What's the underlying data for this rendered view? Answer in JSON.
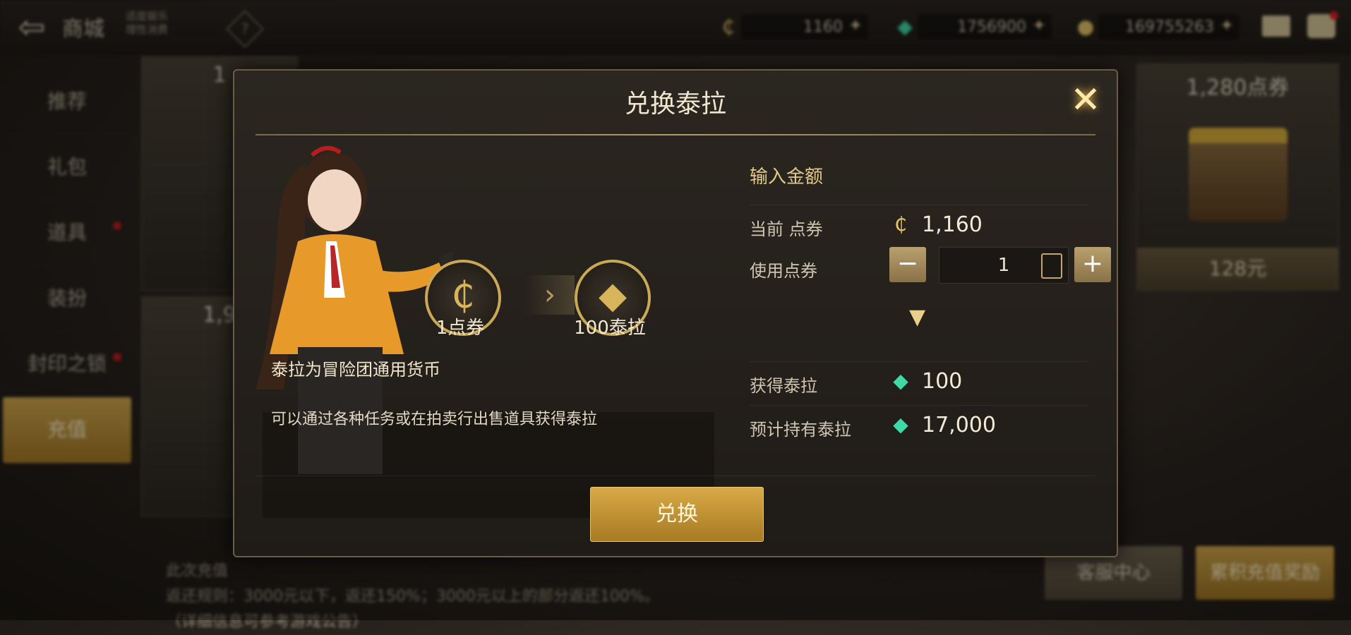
{
  "topbar": {
    "back_icon": "back-arrow-icon",
    "title": "商城",
    "slogan": "适度娱乐 理性消费",
    "help_glyph": "?",
    "currencies": [
      {
        "icon": "point-coupon-icon",
        "value": "1160"
      },
      {
        "icon": "tera-crystal-icon",
        "value": "1756900"
      },
      {
        "icon": "gold-coin-icon",
        "value": "169755263"
      }
    ],
    "plus_glyph": "✦"
  },
  "sidebar": {
    "items": [
      {
        "label": "推荐",
        "dot": false
      },
      {
        "label": "礼包",
        "dot": false
      },
      {
        "label": "道具",
        "dot": true
      },
      {
        "label": "装扮",
        "dot": false
      },
      {
        "label": "封印之锁",
        "dot": true
      },
      {
        "label": "充值",
        "dot": false,
        "active": true
      }
    ]
  },
  "background": {
    "card_right": {
      "head": "1,280点券",
      "price": "128元"
    },
    "card_top_left_head": "1",
    "card_mid_left_head": "1,9",
    "bottom_lines": [
      "此次充值",
      "返还规则：3000元以下，返还150%；3000元以上的部分返还100%。",
      "（详细信息可参考游戏公告）"
    ],
    "service_button": "客服中心",
    "reward_button": "累积充值奖励"
  },
  "dialog": {
    "title": "兑换泰拉",
    "from_label": "1点券",
    "to_label": "100泰拉",
    "desc_line1": "泰拉为冒险团通用货币",
    "desc_line2": "可以通过各种任务或在拍卖行出售道具获得泰拉",
    "input_heading": "输入金额",
    "current_label": "当前 点券",
    "current_value": "1,160",
    "use_label": "使用点券",
    "use_value": "1",
    "get_label": "获得泰拉",
    "get_value": "100",
    "estimate_label": "预计持有泰拉",
    "estimate_value": "17,000",
    "exchange_button": "兑换",
    "colors": {
      "accent": "#d8aa48",
      "teal": "#3fd8a8"
    }
  }
}
